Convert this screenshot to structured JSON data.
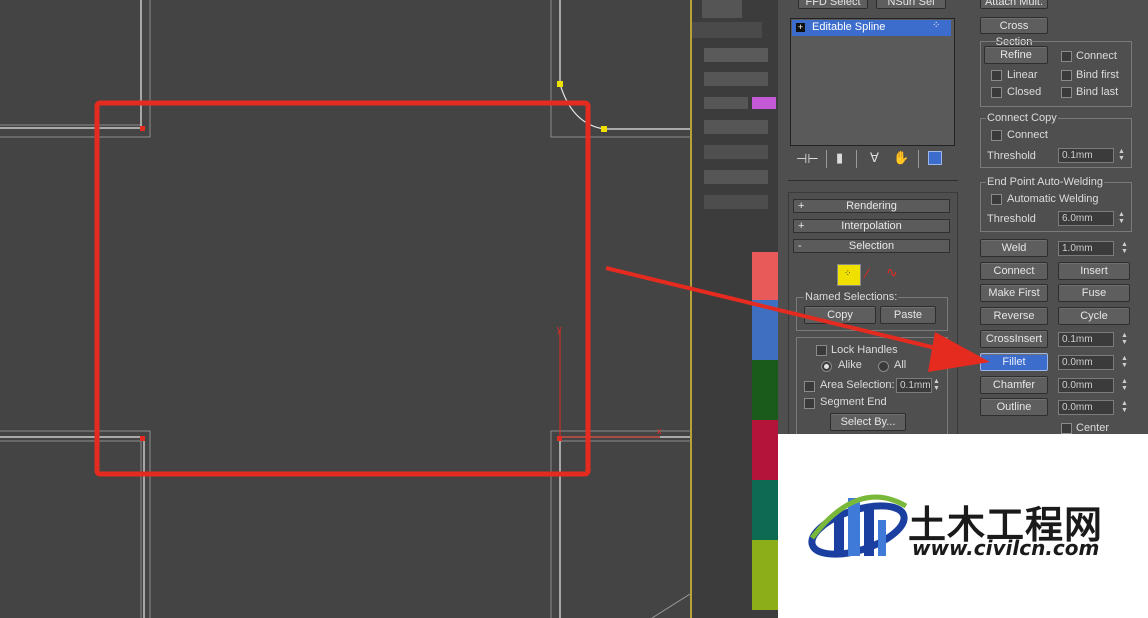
{
  "viewport": {
    "axis_y": "y",
    "axis_x": "x"
  },
  "modifier_stack": {
    "header_buttons": [
      "FFD Select",
      "NSurf Sel"
    ],
    "item": "Editable Spline",
    "icons": [
      "pin-stack-icon",
      "show-end-result-icon",
      "make-unique-icon",
      "remove-modifier-icon",
      "configure-sets-icon"
    ]
  },
  "rollouts": {
    "rendering": "Rendering",
    "interpolation": "Interpolation",
    "selection": "Selection",
    "plus": "+",
    "minus": "-"
  },
  "selection": {
    "named_selections": "Named Selections:",
    "copy": "Copy",
    "paste": "Paste",
    "lock_handles": "Lock Handles",
    "alike": "Alike",
    "all": "All",
    "area_selection": "Area Selection:",
    "area_value": "0.1mm",
    "segment_end": "Segment End",
    "select_by": "Select By..."
  },
  "geometry": {
    "attach_mult": "Attach Mult.",
    "cross_section": "Cross Section",
    "refine": "Refine",
    "connect": "Connect",
    "linear": "Linear",
    "bind_first": "Bind first",
    "closed": "Closed",
    "bind_last": "Bind last",
    "connect_copy": "Connect Copy",
    "connect_copy_chk": "Connect",
    "threshold": "Threshold",
    "threshold_value": "0.1mm",
    "auto_weld_title": "End Point Auto-Welding",
    "automatic_welding": "Automatic Welding",
    "threshold2": "Threshold",
    "threshold2_value": "6.0mm",
    "weld": "Weld",
    "weld_value": "1.0mm",
    "connect_btn": "Connect",
    "insert": "Insert",
    "make_first": "Make First",
    "fuse": "Fuse",
    "reverse": "Reverse",
    "cycle": "Cycle",
    "crossinsert": "CrossInsert",
    "crossinsert_value": "0.1mm",
    "fillet": "Fillet",
    "fillet_value": "0.0mm",
    "chamfer": "Chamfer",
    "chamfer_value": "0.0mm",
    "outline": "Outline",
    "outline_value": "0.0mm",
    "center": "Center"
  },
  "watermark": {
    "text": "土木工程网",
    "url": "www.civilcn.com"
  },
  "colors": {
    "highlight_box": "#e52b20",
    "arrow": "#e52b20",
    "selected_blue": "#3d6dcc",
    "vertex_yellow": "#f0e000"
  }
}
